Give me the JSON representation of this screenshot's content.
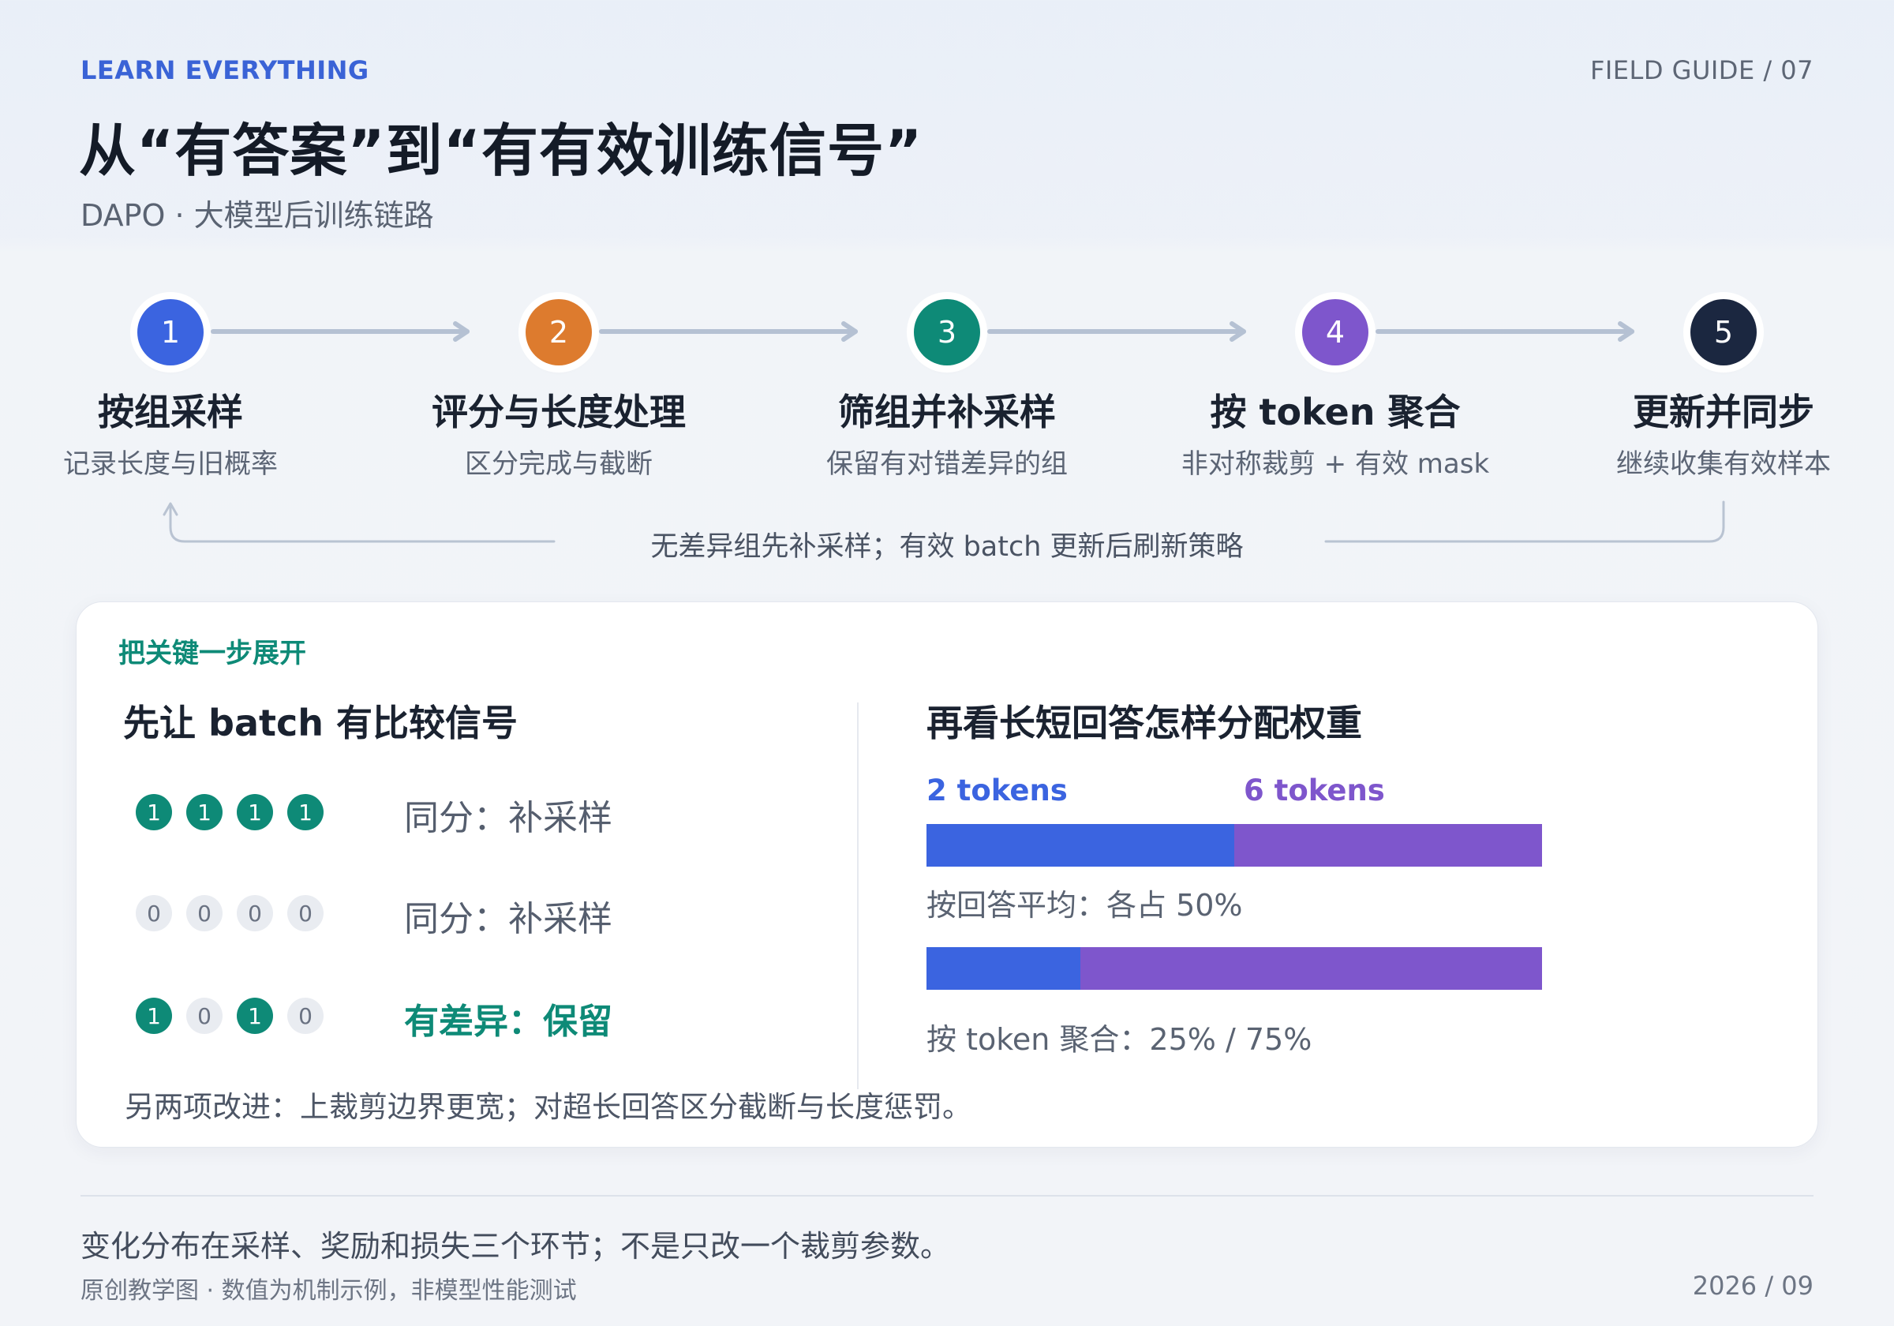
{
  "header": {
    "kicker": "LEARN EVERYTHING",
    "guide": "FIELD GUIDE / 07",
    "title": "从“有答案”到“有有效训练信号”",
    "subtitle": "DAPO · 大模型后训练链路"
  },
  "pipeline": {
    "steps": [
      {
        "num": "1",
        "title": "按组采样",
        "sub": "记录长度与旧概率",
        "color": "#3b64e0"
      },
      {
        "num": "2",
        "title": "评分与长度处理",
        "sub": "区分完成与截断",
        "color": "#dd7b2e"
      },
      {
        "num": "3",
        "title": "筛组并补采样",
        "sub": "保留有对错差异的组",
        "color": "#0e8a77"
      },
      {
        "num": "4",
        "title": "按 token 聚合",
        "sub": "非对称裁剪 + 有效 mask",
        "color": "#7e56cc"
      },
      {
        "num": "5",
        "title": "更新并同步",
        "sub": "继续收集有效样本",
        "color": "#1b2740"
      }
    ],
    "loop_text": "无差异组先补采样；有效 batch 更新后刷新策略"
  },
  "card": {
    "kicker": "把关键一步展开",
    "left": {
      "title": "先让 batch 有比较信号",
      "rows": [
        {
          "scores": [
            "1",
            "1",
            "1",
            "1"
          ],
          "label": "同分：补采样",
          "highlight": false
        },
        {
          "scores": [
            "0",
            "0",
            "0",
            "0"
          ],
          "label": "同分：补采样",
          "highlight": false
        },
        {
          "scores": [
            "1",
            "0",
            "1",
            "0"
          ],
          "label": "有差异：保留",
          "highlight": true
        }
      ]
    },
    "right": {
      "title": "再看长短回答怎样分配权重",
      "short_label": "2 tokens",
      "long_label": "6 tokens",
      "short_color": "#3b64e0",
      "long_color": "#7e56cc",
      "bars": [
        {
          "short_share": 0.5,
          "long_share": 0.5,
          "caption": "按回答平均：各占 50%"
        },
        {
          "short_share": 0.25,
          "long_share": 0.75,
          "caption": "按 token 聚合：25% / 75%"
        }
      ]
    },
    "note": "另两项改进：上裁剪边界更宽；对超长回答区分截断与长度惩罚。"
  },
  "footer": {
    "main": "变化分布在采样、奖励和损失三个环节；不是只改一个裁剪参数。",
    "left": "原创教学图 · 数值为机制示例，非模型性能测试",
    "right": "2026 / 09"
  }
}
